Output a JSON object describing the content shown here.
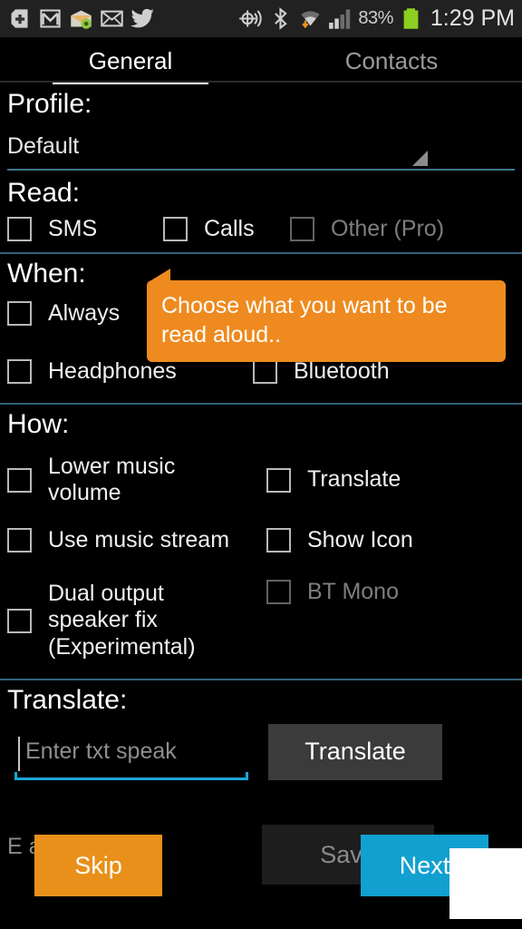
{
  "statusbar": {
    "notification_icons": [
      "plus-badge-icon",
      "gmail-icon",
      "mail-badge-icon",
      "envelope-icon",
      "twitter-icon"
    ],
    "system_icons": [
      "location-icon",
      "bluetooth-icon",
      "wifi-download-icon",
      "signal-icon"
    ],
    "battery_percent": "83%",
    "clock": "1:29 PM"
  },
  "tabs": [
    {
      "label": "General",
      "active": true
    },
    {
      "label": "Contacts",
      "active": false
    }
  ],
  "profile": {
    "title": "Profile:",
    "value": "Default"
  },
  "read": {
    "title": "Read:",
    "items": [
      {
        "label": "SMS",
        "checked": false,
        "disabled": false
      },
      {
        "label": "Calls",
        "checked": false,
        "disabled": false
      },
      {
        "label": "Other (Pro)",
        "checked": false,
        "disabled": true
      }
    ]
  },
  "when": {
    "title": "When:",
    "items": [
      {
        "label": "Always",
        "checked": false,
        "disabled": false
      },
      {
        "label": "Headphones",
        "checked": false,
        "disabled": false
      },
      {
        "label": "Bluetooth",
        "checked": false,
        "disabled": false
      }
    ]
  },
  "how": {
    "title": "How:",
    "items": [
      {
        "label": "Lower music volume",
        "checked": false,
        "disabled": false
      },
      {
        "label": "Translate",
        "checked": false,
        "disabled": false
      },
      {
        "label": "Use music stream",
        "checked": false,
        "disabled": false
      },
      {
        "label": "Show Icon",
        "checked": false,
        "disabled": false
      },
      {
        "label": "Dual output speaker fix (Experimental)",
        "checked": false,
        "disabled": false
      },
      {
        "label": "BT Mono",
        "checked": false,
        "disabled": true
      }
    ]
  },
  "translate": {
    "title": "Translate:",
    "placeholder": "Enter txt speak",
    "value": "",
    "button_label": "Translate"
  },
  "bottom": {
    "obscured_text": "E                    ation",
    "save_label": "Save",
    "skip_label": "Skip",
    "next_label": "Next"
  },
  "tooltip": {
    "text": "Choose what you want to be read aloud.."
  },
  "colors": {
    "tooltip_bg": "#ee8a1f",
    "skip_bg": "#e8901a",
    "next_bg": "#11a0d0",
    "divider": "#33637a",
    "focus_underline": "#1aa7d8",
    "battery": "#8ccf1f"
  }
}
